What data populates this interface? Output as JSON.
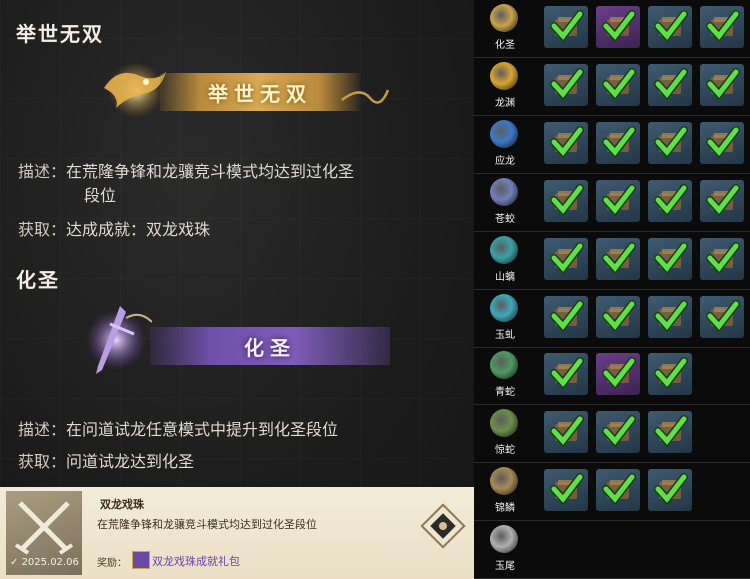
{
  "entries": [
    {
      "section_title": "举世无双",
      "banner_text": "举世无双",
      "desc_label": "描述：",
      "desc_line1": "在荒隆争锋和龙骧竞斗模式均达到过化圣",
      "desc_line2": "段位",
      "get_label": "获取：",
      "get_text": "达成成就：双龙戏珠"
    },
    {
      "section_title": "化圣",
      "banner_text": "化圣",
      "desc_label": "描述：",
      "desc_line1": "在问道试龙任意模式中提升到化圣段位",
      "get_label": "获取：",
      "get_text": "问道试龙达到化圣"
    }
  ],
  "popup": {
    "name": "双龙戏珠",
    "description": "在荒隆争锋和龙骧竞斗模式均达到过化圣段位",
    "date": "2025.02.06",
    "reward_label": "奖励：",
    "reward_name": "双龙戏珠成就礼包"
  },
  "ranks": [
    {
      "label": "化圣",
      "color": "#c9a24a",
      "cells": [
        "blue",
        "purple",
        "blue",
        "blue",
        "blue"
      ]
    },
    {
      "label": "龙渊",
      "color": "#d9a531",
      "cells": [
        "blue",
        "blue",
        "blue",
        "blue"
      ]
    },
    {
      "label": "应龙",
      "color": "#3c78c8",
      "cells": [
        "blue",
        "blue",
        "blue",
        "blue"
      ]
    },
    {
      "label": "苍蛟",
      "color": "#6f7fb8",
      "cells": [
        "blue",
        "blue",
        "blue",
        "blue"
      ]
    },
    {
      "label": "山螭",
      "color": "#3aa1a6",
      "cells": [
        "blue",
        "blue",
        "blue",
        "blue"
      ]
    },
    {
      "label": "玉虬",
      "color": "#3fa8b8",
      "cells": [
        "blue",
        "blue",
        "blue",
        "blue"
      ]
    },
    {
      "label": "青蛇",
      "color": "#4d9a63",
      "cells": [
        "blue",
        "purple",
        "blue"
      ]
    },
    {
      "label": "惊蛇",
      "color": "#6d8f4a",
      "cells": [
        "blue",
        "blue",
        "blue"
      ]
    },
    {
      "label": "锦鳞",
      "color": "#a68a55",
      "cells": [
        "blue",
        "blue",
        "blue"
      ]
    },
    {
      "label": "玉尾",
      "color": "#b0b0b0",
      "cells": []
    }
  ],
  "colors": {
    "check": "#5fe04a",
    "gold": "#d9ab55",
    "purple": "#7e5db8"
  }
}
